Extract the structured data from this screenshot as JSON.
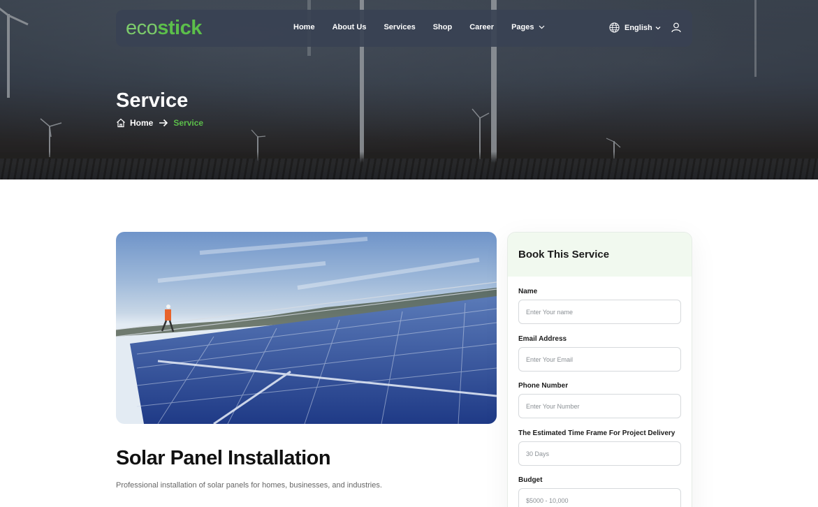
{
  "brand": {
    "logo_part1": "eco",
    "logo_part2": "stick"
  },
  "nav": {
    "items": [
      {
        "label": "Home"
      },
      {
        "label": "About Us"
      },
      {
        "label": "Services"
      },
      {
        "label": "Shop"
      },
      {
        "label": "Career"
      },
      {
        "label": "Pages"
      }
    ],
    "language": "English"
  },
  "hero": {
    "title": "Service",
    "breadcrumb": {
      "home": "Home",
      "current": "Service"
    }
  },
  "service": {
    "title": "Solar Panel Installation",
    "description": "Professional installation of solar panels for homes, businesses, and industries."
  },
  "booking": {
    "title": "Book This Service",
    "fields": [
      {
        "label": "Name",
        "placeholder": "Enter Your name"
      },
      {
        "label": "Email Address",
        "placeholder": "Enter Your Email"
      },
      {
        "label": "Phone Number",
        "placeholder": "Enter Your Number"
      },
      {
        "label": "The Estimated Time Frame For Project Delivery",
        "placeholder": "30 Days"
      },
      {
        "label": "Budget",
        "placeholder": "$5000 - 10,000"
      }
    ]
  },
  "colors": {
    "accent": "#5cbf4a",
    "nav_bg": "#3a4254",
    "card_head": "#f1f9ef"
  },
  "icons": {
    "globe": "globe-icon",
    "user": "user-icon",
    "home": "home-icon",
    "arrow": "arrow-right-icon",
    "chevron": "chevron-down-icon"
  }
}
